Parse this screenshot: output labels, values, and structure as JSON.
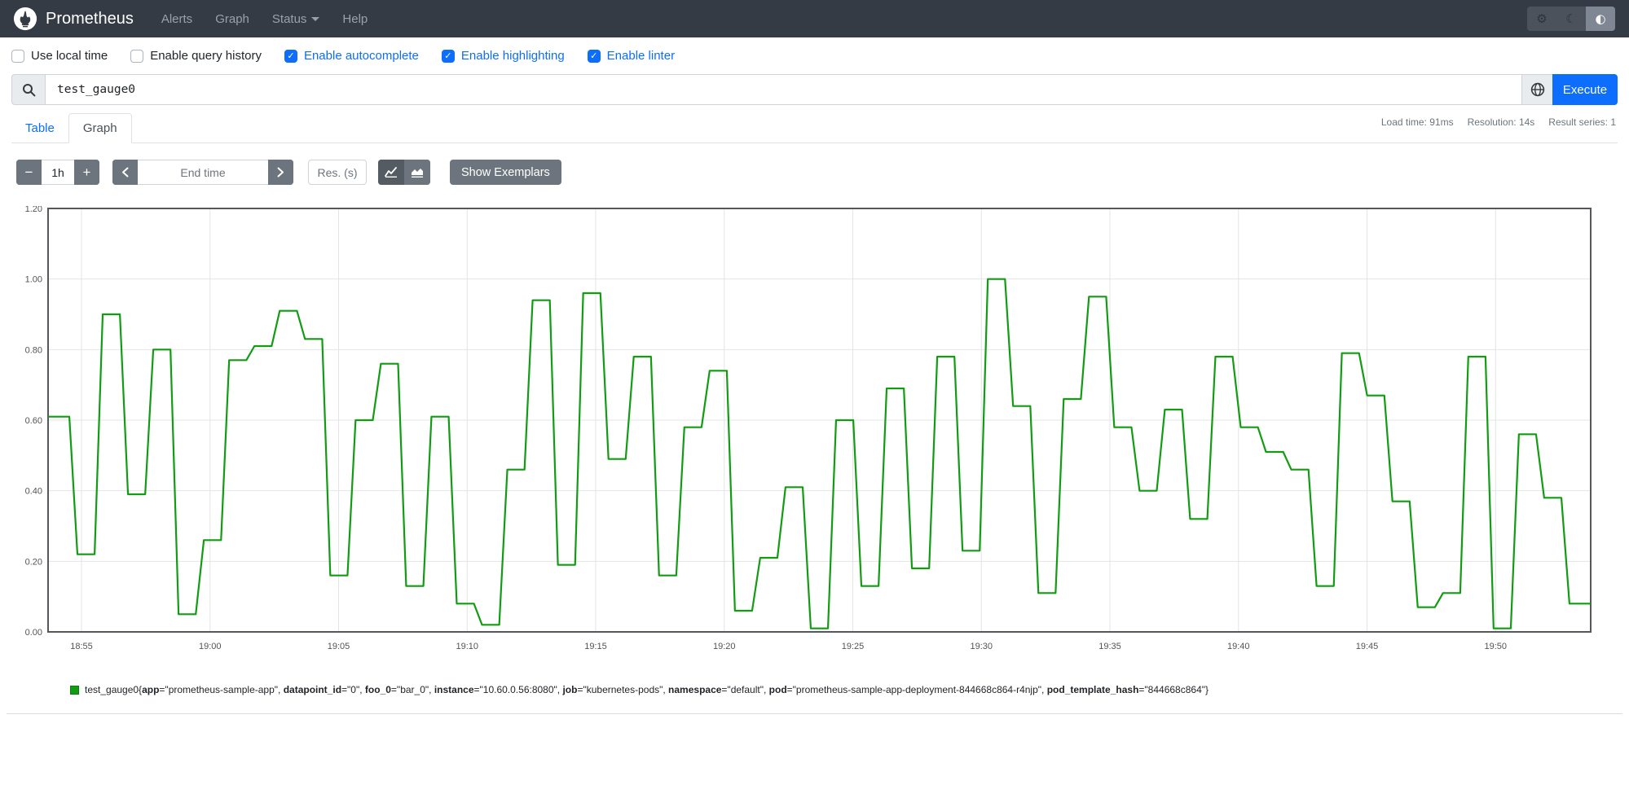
{
  "navbar": {
    "brand": "Prometheus",
    "links": [
      {
        "label": "Alerts"
      },
      {
        "label": "Graph"
      },
      {
        "label": "Status",
        "has_caret": true
      },
      {
        "label": "Help"
      }
    ],
    "theme_toggle": {
      "icons": [
        "gear-icon",
        "moon-icon",
        "contrast-icon"
      ],
      "gear_glyph": "⚙",
      "moon_glyph": "☾",
      "contrast_glyph": "◐",
      "active": "contrast-icon"
    }
  },
  "options": [
    {
      "label": "Use local time",
      "checked": false
    },
    {
      "label": "Enable query history",
      "checked": false
    },
    {
      "label": "Enable autocomplete",
      "checked": true
    },
    {
      "label": "Enable highlighting",
      "checked": true
    },
    {
      "label": "Enable linter",
      "checked": true
    }
  ],
  "option_check_glyph": "✓",
  "query": {
    "value": "test_gauge0",
    "execute_label": "Execute"
  },
  "stats": {
    "load_time": "Load time: 91ms",
    "resolution": "Resolution: 14s",
    "result_series": "Result series: 1"
  },
  "tabs": [
    {
      "label": "Table",
      "active": false
    },
    {
      "label": "Graph",
      "active": true
    }
  ],
  "controls": {
    "minus_label": "−",
    "plus_label": "+",
    "range_value": "1h",
    "end_time_placeholder": "End time",
    "res_placeholder": "Res. (s)",
    "show_exemplars_label": "Show Exemplars"
  },
  "chart_data": {
    "type": "line",
    "step": true,
    "line_color": "#129c12",
    "grid": true,
    "resolution_s": 14,
    "y_axis": {
      "min": 0,
      "max": 1.2,
      "tick_labels": [
        "0.00",
        "0.20",
        "0.40",
        "0.60",
        "0.80",
        "1.00",
        "1.20"
      ]
    },
    "x_axis": {
      "tick_labels": [
        "18:55",
        "19:00",
        "19:05",
        "19:10",
        "19:15",
        "19:20",
        "19:25",
        "19:30",
        "19:35",
        "19:40",
        "19:45",
        "19:50"
      ],
      "first_tick_offset_min": 1.3,
      "tick_interval_min": 5,
      "total_span_min": 60
    },
    "series": [
      {
        "name": "test_gauge0",
        "values": [
          0.61,
          0.22,
          0.9,
          0.39,
          0.8,
          0.05,
          0.26,
          0.77,
          0.81,
          0.91,
          0.83,
          0.16,
          0.6,
          0.76,
          0.13,
          0.61,
          0.08,
          0.02,
          0.46,
          0.94,
          0.19,
          0.96,
          0.49,
          0.78,
          0.16,
          0.58,
          0.74,
          0.06,
          0.21,
          0.41,
          0.01,
          0.6,
          0.13,
          0.69,
          0.18,
          0.78,
          0.23,
          1.0,
          0.64,
          0.11,
          0.66,
          0.95,
          0.58,
          0.4,
          0.63,
          0.32,
          0.78,
          0.58,
          0.51,
          0.46,
          0.13,
          0.79,
          0.67,
          0.37,
          0.07,
          0.11,
          0.78,
          0.01,
          0.56,
          0.38,
          0.08
        ]
      }
    ]
  },
  "legend": {
    "metric": "test_gauge0",
    "labels": [
      {
        "k": "app",
        "v": "prometheus-sample-app"
      },
      {
        "k": "datapoint_id",
        "v": "0"
      },
      {
        "k": "foo_0",
        "v": "bar_0"
      },
      {
        "k": "instance",
        "v": "10.60.0.56:8080"
      },
      {
        "k": "job",
        "v": "kubernetes-pods"
      },
      {
        "k": "namespace",
        "v": "default"
      },
      {
        "k": "pod",
        "v": "prometheus-sample-app-deployment-844668c864-r4njp"
      },
      {
        "k": "pod_template_hash",
        "v": "844668c864"
      }
    ]
  }
}
